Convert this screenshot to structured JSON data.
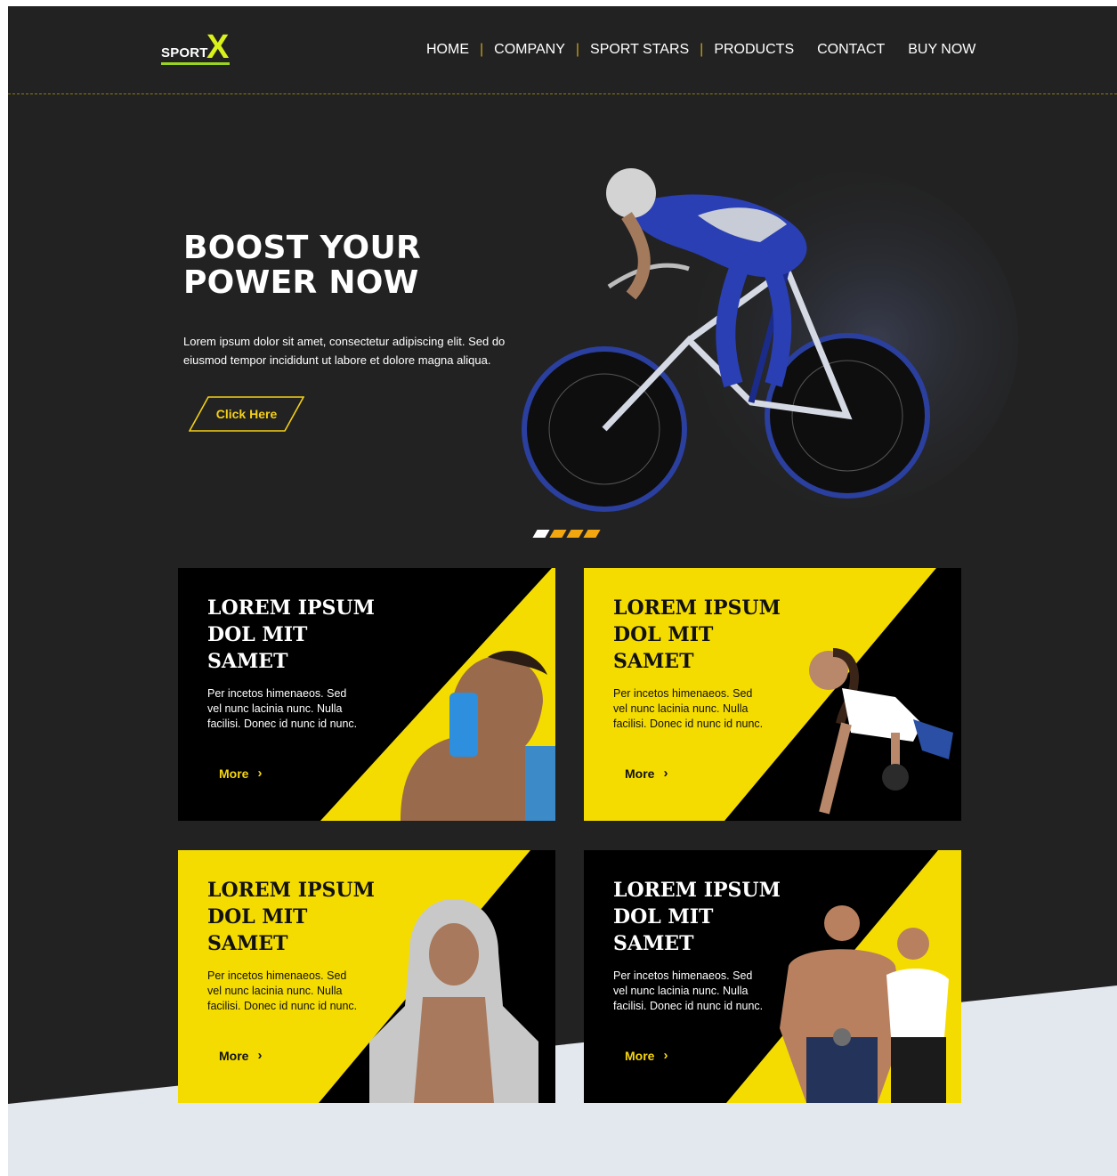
{
  "brand": {
    "logo_word": "SPORT",
    "logo_mark": "X",
    "accent_yellow": "#F5DC00",
    "accent_lime": "#D9F21A",
    "background": "#222222"
  },
  "nav": {
    "items": [
      {
        "label": "HOME"
      },
      {
        "label": "COMPANY"
      },
      {
        "label": "SPORT STARS"
      },
      {
        "label": "PRODUCTS"
      },
      {
        "label": "CONTACT"
      },
      {
        "label": "BUY NOW"
      }
    ]
  },
  "hero": {
    "title": "BOOST YOUR POWER NOW",
    "body": "Lorem ipsum dolor sit amet, consectetur adipiscing elit. Sed do eiusmod tempor incididunt ut labore et dolore magna aliqua.",
    "cta_label": "Click Here",
    "image": "cyclist-photo",
    "slider": {
      "count": 4,
      "active_index": 0
    }
  },
  "cards": [
    {
      "title": "LOREM IPSUM DOL MIT SAMET",
      "body": "Per incetos himenaeos. Sed vel nunc lacinia nunc. Nulla facilisi. Donec id nunc id nunc.",
      "more_label": "More",
      "theme": "dark",
      "image": "athlete-with-shaker-photo"
    },
    {
      "title": "LOREM IPSUM DOL MIT SAMET",
      "body": "Per incetos himenaeos. Sed vel nunc lacinia nunc. Nulla facilisi. Donec id nunc id nunc.",
      "more_label": "More",
      "theme": "light",
      "image": "woman-dumbbell-photo"
    },
    {
      "title": "LOREM IPSUM DOL MIT SAMET",
      "body": "Per incetos himenaeos. Sed vel nunc lacinia nunc. Nulla facilisi. Donec id nunc id nunc.",
      "more_label": "More",
      "theme": "light",
      "image": "man-hoodie-photo"
    },
    {
      "title": "LOREM IPSUM DOL MIT SAMET",
      "body": "Per incetos himenaeos. Sed vel nunc lacinia nunc. Nulla facilisi. Donec id nunc id nunc.",
      "more_label": "More",
      "theme": "dark",
      "image": "fitness-couple-photo"
    }
  ]
}
